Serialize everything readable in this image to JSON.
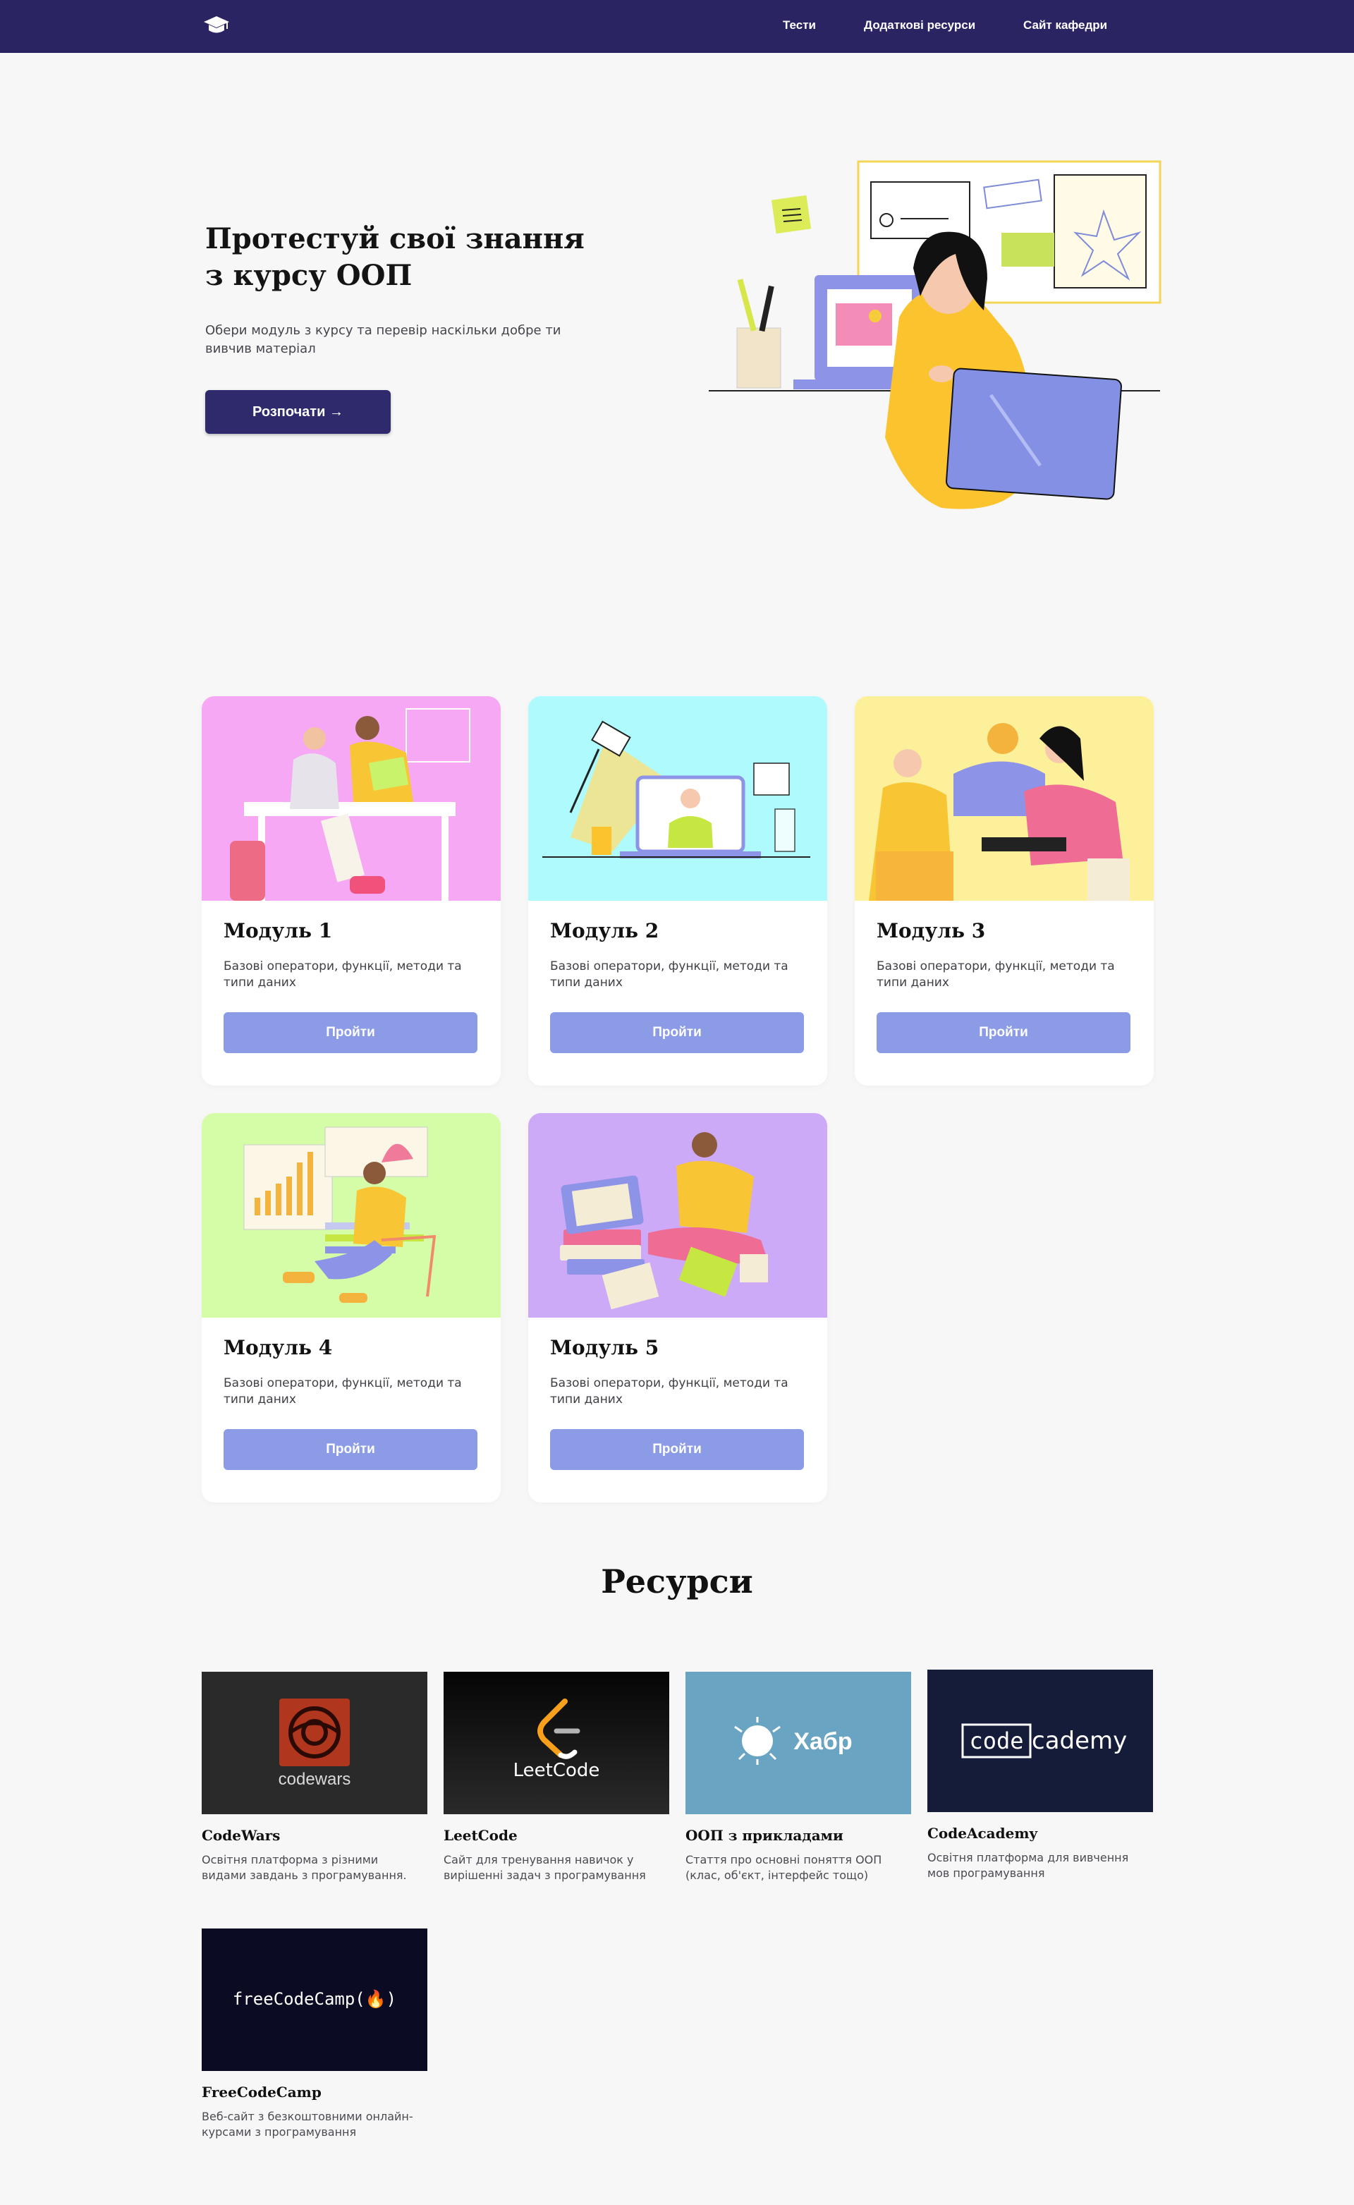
{
  "nav": {
    "links": [
      "Тести",
      "Додаткові ресурси",
      "Сайт кафедри"
    ]
  },
  "hero": {
    "title": "Протестуй свої знання\nз курсу ООП",
    "subtitle": "Обери модуль з курсу та перевір наскільки добре ти вивчив матеріал",
    "button": "Розпочати →"
  },
  "modules": [
    {
      "title": "Модуль 1",
      "desc": "Базові оператори, функції, методи та типи даних",
      "button": "Пройти",
      "color": "#f6a8f5"
    },
    {
      "title": "Модуль 2",
      "desc": "Базові оператори, функції, методи та типи даних",
      "button": "Пройти",
      "color": "#aefafc"
    },
    {
      "title": "Модуль 3",
      "desc": "Базові оператори, функції, методи та типи даних",
      "button": "Пройти",
      "color": "#fdf09b"
    },
    {
      "title": "Модуль 4",
      "desc": "Базові оператори, функції, методи та типи даних",
      "button": "Пройти",
      "color": "#d5fda7"
    },
    {
      "title": "Модуль 5",
      "desc": "Базові оператори, функції, методи та типи даних",
      "button": "Пройти",
      "color": "#cdaaf8"
    }
  ],
  "resources": {
    "title": "Ресурси",
    "items": [
      {
        "name": "CodeWars",
        "desc": "Освітня платформа з різними видами завдань з програмування.",
        "logo_text": "codewars"
      },
      {
        "name": "LeetCode",
        "desc": "Сайт для тренування навичок у вирішенні задач з програмування",
        "logo_text": "LeetCode"
      },
      {
        "name": "ООП з прикладами",
        "desc": "Стаття про основні поняття ООП (клас, об'єкт, інтерфейс тощо)",
        "logo_text": "Хабр"
      },
      {
        "name": "CodeAcademy",
        "desc": "Освітня платформа для вивчення мов програмування",
        "logo_text_boxed": "code",
        "logo_text_rest": "cademy"
      },
      {
        "name": "FreeCodeCamp",
        "desc": "Веб-сайт з безкоштовними онлайн-курсами з програмування",
        "logo_text": "freeCodeCamp(🔥)"
      }
    ]
  },
  "colors": {
    "nav_bg": "#2b2462",
    "primary_button": "#2e2a6b",
    "module_button": "#8b9be6",
    "page_bg": "#f7f7f7"
  }
}
